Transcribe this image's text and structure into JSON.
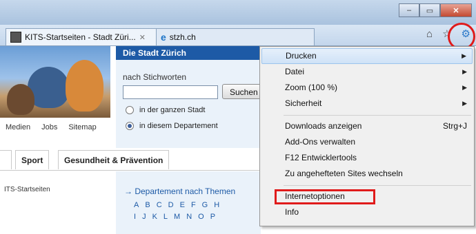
{
  "window": {
    "minimize_glyph": "–",
    "maximize_glyph": "▭",
    "close_glyph": "✕"
  },
  "tabs": [
    {
      "label": "KITS-Startseiten - Stadt Züri...",
      "close": "✕"
    },
    {
      "label": "stzh.ch"
    }
  ],
  "toolbar": {
    "home_icon": "home-icon",
    "favorites_icon": "star-icon",
    "tools_icon": "gear-icon"
  },
  "page": {
    "top_links": [
      "Medien",
      "Jobs",
      "Sitemap"
    ],
    "stadt_title": "Die Stadt Zürich",
    "search": {
      "label": "nach Stichworten",
      "value": "",
      "button": "Suchen",
      "radio_all": "in der ganzen Stadt",
      "radio_dept": "in diesem Departement",
      "selected": "dept"
    },
    "nav_tabs": [
      "Sport",
      "Gesundheit & Prävention"
    ],
    "breadcrumb": "ITS-Startseiten",
    "departement_link": "→ Departement nach Themen",
    "alphabet_row1": [
      "A",
      "B",
      "C",
      "D",
      "E",
      "F",
      "G",
      "H"
    ],
    "alphabet_row2": [
      "I",
      "J",
      "K",
      "L",
      "M",
      "N",
      "O",
      "P"
    ]
  },
  "menu": {
    "items": [
      {
        "label": "Drucken",
        "submenu": true,
        "highlighted": true
      },
      {
        "label": "Datei",
        "submenu": true
      },
      {
        "label": "Zoom (100 %)",
        "submenu": true
      },
      {
        "label": "Sicherheit",
        "submenu": true
      },
      {
        "label": "Downloads anzeigen",
        "shortcut": "Strg+J"
      },
      {
        "label": "Add-Ons verwalten"
      },
      {
        "label": "F12 Entwicklertools"
      },
      {
        "label": "Zu angehefteten Sites wechseln"
      },
      {
        "label": "Internetoptionen",
        "annotated": true
      },
      {
        "label": "Info"
      }
    ]
  },
  "colors": {
    "annotation": "#e01b1b",
    "site_blue": "#1d5aa6",
    "menu_bg": "#f0f0f0"
  }
}
